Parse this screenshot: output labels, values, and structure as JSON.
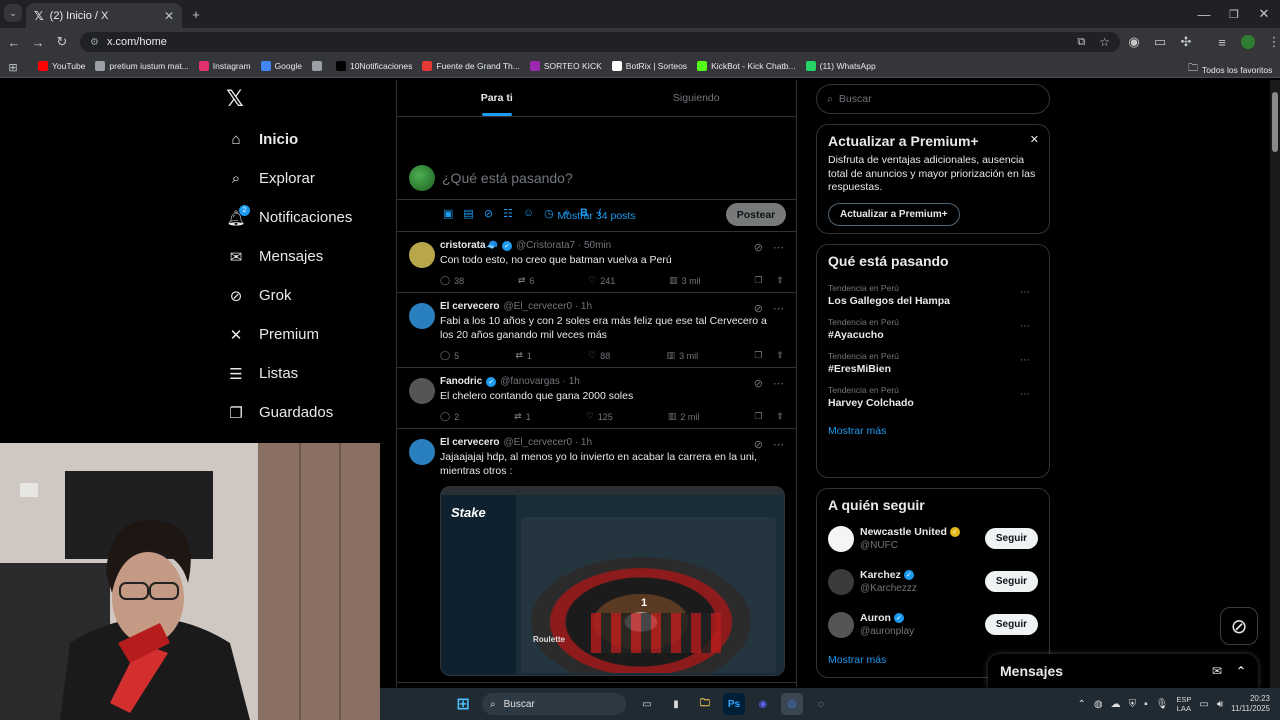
{
  "browser": {
    "tab_title": "(2) Inicio / X",
    "tab_icon": "x-logo-icon",
    "new_tab": "+",
    "url": "x.com/home",
    "bookmarks": [
      {
        "label": "YouTube",
        "color": "#ff0000"
      },
      {
        "label": "pretium iustum mat...",
        "color": "#9aa0a6"
      },
      {
        "label": "Instagram",
        "color": "#e1306c"
      },
      {
        "label": "Google",
        "color": "#4285f4"
      },
      {
        "label": "",
        "color": "#9aa0a6"
      },
      {
        "label": "10Notificaciones",
        "color": "#000000"
      },
      {
        "label": "Fuente de Grand Th...",
        "color": "#e53935"
      },
      {
        "label": "SORTEO KICK",
        "color": "#9c27b0"
      },
      {
        "label": "BotRix | Sorteos",
        "color": "#ffffff"
      },
      {
        "label": "KickBot - Kick Chatb...",
        "color": "#53fc18"
      },
      {
        "label": "(11) WhatsApp",
        "color": "#25d366"
      }
    ],
    "all_bookmarks": "Todos los favoritos"
  },
  "sidebar": {
    "logo": "𝕏",
    "items": [
      {
        "label": "Inicio",
        "icon": "home-icon",
        "glyph": "⌂"
      },
      {
        "label": "Explorar",
        "icon": "search-icon",
        "glyph": "⌕"
      },
      {
        "label": "Notificaciones",
        "icon": "bell-icon",
        "glyph": "🔔︎",
        "badge": "2"
      },
      {
        "label": "Mensajes",
        "icon": "mail-icon",
        "glyph": "✉"
      },
      {
        "label": "Grok",
        "icon": "grok-icon",
        "glyph": "⊘"
      },
      {
        "label": "Premium",
        "icon": "x-icon",
        "glyph": "✕"
      },
      {
        "label": "Listas",
        "icon": "list-icon",
        "glyph": "☰"
      },
      {
        "label": "Guardados",
        "icon": "bookmark-icon",
        "glyph": "❐"
      }
    ]
  },
  "main": {
    "tabs": [
      "Para ti",
      "Siguiendo"
    ],
    "compose_placeholder": "¿Qué está pasando?",
    "post_button": "Postear",
    "show_posts": "Mostrar 34 posts",
    "posts": [
      {
        "name": "cristorata🧢",
        "verified": true,
        "handle": "@Cristorata7 · 50min",
        "text": "Con todo esto, no creo que batman vuelva a Perú",
        "replies": "38",
        "reposts": "6",
        "likes": "241",
        "views": "3 mil",
        "avatar": "#b8a64a"
      },
      {
        "name": "El cervecero",
        "verified": false,
        "handle": "@El_cervecer0 · 1h",
        "text": "Fabi a los 10 años y con 2 soles era más feliz que ese tal Cervecero a los 20 años  ganando mil veces más",
        "replies": "5",
        "reposts": "1",
        "likes": "88",
        "views": "3 mil",
        "avatar": "#2a7fbf"
      },
      {
        "name": "Fanodric",
        "verified": true,
        "handle": "@fanovargas · 1h",
        "text": "El chelero contando que gana 2000 soles",
        "replies": "2",
        "reposts": "1",
        "likes": "125",
        "views": "2 mil",
        "avatar": "#555555"
      },
      {
        "name": "El cervecero",
        "verified": false,
        "handle": "@El_cervecer0 · 1h",
        "text": "Jajaajajaj hdp, al menos yo lo invierto en acabar la carrera en la uni, mientras otros :",
        "avatar": "#2a7fbf"
      }
    ],
    "media": {
      "logo": "Stake",
      "number": "1",
      "brand": "Roulette"
    }
  },
  "right": {
    "search_placeholder": "Buscar",
    "premium": {
      "title": "Actualizar a Premium+",
      "text": "Disfruta de ventajas adicionales, ausencia total de anuncios y mayor priorización en las respuestas.",
      "button": "Actualizar a Premium+"
    },
    "trends": {
      "title": "Qué está pasando",
      "items": [
        {
          "context": "Tendencia en Perú",
          "topic": "Los Gallegos del Hampa"
        },
        {
          "context": "Tendencia en Perú",
          "topic": "#Ayacucho"
        },
        {
          "context": "Tendencia en Perú",
          "topic": "#EresMiBien"
        },
        {
          "context": "Tendencia en Perú",
          "topic": "Harvey Colchado"
        }
      ],
      "more": "Mostrar más"
    },
    "follow": {
      "title": "A quién seguir",
      "items": [
        {
          "name": "Newcastle United",
          "handle": "@NUFC",
          "badge": "gold",
          "button": "Seguir"
        },
        {
          "name": "Karchez",
          "handle": "@Karchezzz",
          "badge": "blue",
          "button": "Seguir"
        },
        {
          "name": "Auron",
          "handle": "@auronplay",
          "badge": "blue",
          "button": "Seguir"
        }
      ],
      "more": "Mostrar más"
    }
  },
  "messages": {
    "label": "Mensajes"
  },
  "taskbar": {
    "search": "Buscar",
    "lang": "ESP",
    "lang2": "LAA",
    "time": "20:23",
    "date": "11/11/2025"
  }
}
